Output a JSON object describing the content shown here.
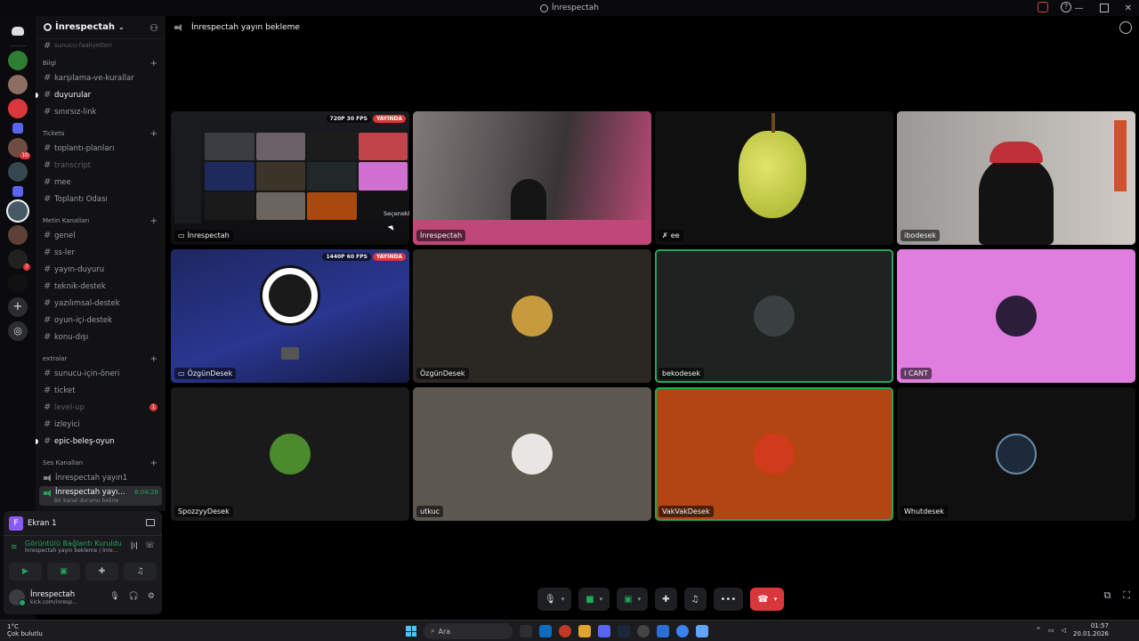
{
  "window": {
    "title": "İnrespectah"
  },
  "server": {
    "name": "İnrespectah",
    "partial_top_item": "sunucu-faaliyetleri"
  },
  "categories": [
    {
      "name": "Bilgi",
      "channels": [
        {
          "label": "karşılama-ve-kurallar",
          "state": "normal"
        },
        {
          "label": "duyurular",
          "state": "bold"
        },
        {
          "label": "sınırsız-link",
          "state": "normal"
        }
      ]
    },
    {
      "name": "Tickets",
      "channels": [
        {
          "label": "toplantı-planları",
          "state": "normal"
        },
        {
          "label": "transcript",
          "state": "muted"
        },
        {
          "label": "mee",
          "state": "normal"
        },
        {
          "label": "Toplantı Odası",
          "state": "normal"
        }
      ]
    },
    {
      "name": "Metin Kanalları",
      "channels": [
        {
          "label": "genel",
          "state": "normal"
        },
        {
          "label": "ss-ler",
          "state": "normal"
        },
        {
          "label": "yayın-duyuru",
          "state": "normal"
        },
        {
          "label": "teknik-destek",
          "state": "normal"
        },
        {
          "label": "yazılımsal-destek",
          "state": "normal"
        },
        {
          "label": "oyun-içi-destek",
          "state": "normal"
        },
        {
          "label": "konu-dışı",
          "state": "normal"
        }
      ]
    },
    {
      "name": "extralar",
      "channels": [
        {
          "label": "sunucu-için-öneri",
          "state": "normal"
        },
        {
          "label": "ticket",
          "state": "normal"
        },
        {
          "label": "level-up",
          "state": "muted",
          "badge": "1"
        },
        {
          "label": "izleyici",
          "state": "normal"
        },
        {
          "label": "epic-beleş-oyun",
          "state": "bold"
        }
      ]
    },
    {
      "name": "Ses Kanalları",
      "voice_channels": [
        {
          "label": "İnrespectah yayın1"
        },
        {
          "label": "İnrespectah yayı...",
          "active": true,
          "time": "6:04:26",
          "status": "Bir kanal durumu belirle"
        }
      ]
    }
  ],
  "user_panel": {
    "stream_label": "Ekran 1",
    "stream_initial": "F",
    "voice_status": "Görüntülü Bağlantı Kuruldu",
    "voice_sub": "İnrespectah yayın bekleme / İnre...",
    "username": "İnrespectah",
    "user_status": "kick.com/inresp..."
  },
  "call": {
    "header": "İnrespectah yayın bekleme",
    "tooltip": "Seçenekler",
    "tiles": [
      {
        "name": "İnrespectah",
        "quality": "720P 30 FPS",
        "live": "YAYINDA",
        "kind": "screen"
      },
      {
        "name": "İnrespectah",
        "kind": "camera-room"
      },
      {
        "name": "ee",
        "kind": "camera-pear"
      },
      {
        "name": "ibodesek",
        "kind": "camera-person",
        "speaking": true
      },
      {
        "name": "ÖzgünDesek",
        "quality": "1440P 60 FPS",
        "live": "YAYINDA",
        "kind": "obs"
      },
      {
        "name": "ÖzgünDesek",
        "kind": "avatar",
        "bg": "#2b2824",
        "av": "#c79a3e"
      },
      {
        "name": "bekodesek",
        "kind": "avatar",
        "bg": "#1e2322",
        "av": "#3a3f40",
        "speaking": true
      },
      {
        "name": "I CANT",
        "kind": "avatar",
        "bg": "#e07ee0",
        "av": "#2a1e3a"
      },
      {
        "name": "SpozzyyDesek",
        "kind": "avatar",
        "bg": "#1a1a1a",
        "av": "#4c8a2e"
      },
      {
        "name": "utkuc",
        "kind": "avatar",
        "bg": "#5c5850",
        "av": "#e8e6e2"
      },
      {
        "name": "VakVakDesek",
        "kind": "avatar",
        "bg": "#b34512",
        "av": "#d13a1a",
        "speaking": true
      },
      {
        "name": "Whutdesek",
        "kind": "avatar",
        "bg": "#101010",
        "av": "#1d2a3a"
      }
    ]
  },
  "taskbar": {
    "weather_temp": "1°C",
    "weather_desc": "Çok bulutlu",
    "search_label": "Ara",
    "time": "01:57",
    "date": "20.01.2026"
  }
}
